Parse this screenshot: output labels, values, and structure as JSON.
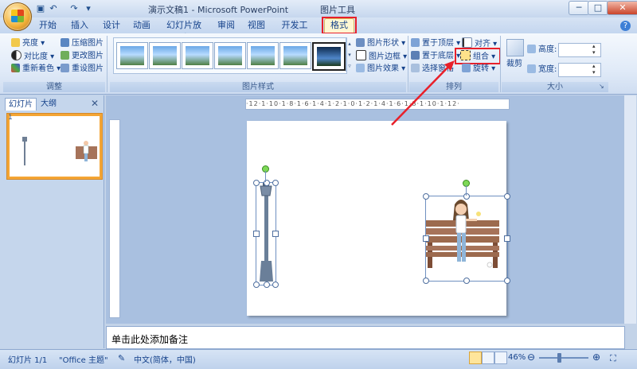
{
  "window": {
    "doc_title": "演示文稿1 - Microsoft PowerPoint",
    "context_title": "图片工具",
    "min_label": "─",
    "max_label": "□",
    "close_label": "✕"
  },
  "tabs": [
    {
      "label": "开始"
    },
    {
      "label": "插入"
    },
    {
      "label": "设计"
    },
    {
      "label": "动画"
    },
    {
      "label": "幻灯片放映"
    },
    {
      "label": "审阅"
    },
    {
      "label": "视图"
    },
    {
      "label": "开发工具"
    },
    {
      "label": "格式"
    }
  ],
  "ribbon": {
    "adjust": {
      "brightness": "亮度",
      "contrast": "对比度",
      "recolor": "重新着色",
      "compress": "压缩图片",
      "change": "更改图片",
      "reset": "重设图片",
      "label": "调整"
    },
    "picture_styles": {
      "shape": "图片形状",
      "border": "图片边框",
      "effects": "图片效果",
      "label": "图片样式"
    },
    "arrange": {
      "bring_front": "置于顶层",
      "send_back": "置于底层",
      "selection_pane": "选择窗格",
      "align": "对齐",
      "group": "组合",
      "rotate": "旋转",
      "label": "排列"
    },
    "size": {
      "crop": "裁剪",
      "height": "高度:",
      "width": "宽度:",
      "label": "大小"
    }
  },
  "panel": {
    "tab_slides": "幻灯片",
    "tab_outline": "大纲",
    "close": "✕",
    "slide_number": "1"
  },
  "ruler_text": "·12·1·10·1·8·1·6·1·4·1·2·1·0·1·2·1·4·1·6·1·8·1·10·1·12·",
  "notes_placeholder": "单击此处添加备注",
  "status": {
    "slide": "幻灯片 1/1",
    "theme": "\"Office 主题\"",
    "language": "中文(简体，中国)",
    "zoom": "46%"
  },
  "colors": {
    "accent_red": "#e8202a",
    "ribbon_blue": "#15428b",
    "selected_slide": "#f4a534"
  }
}
